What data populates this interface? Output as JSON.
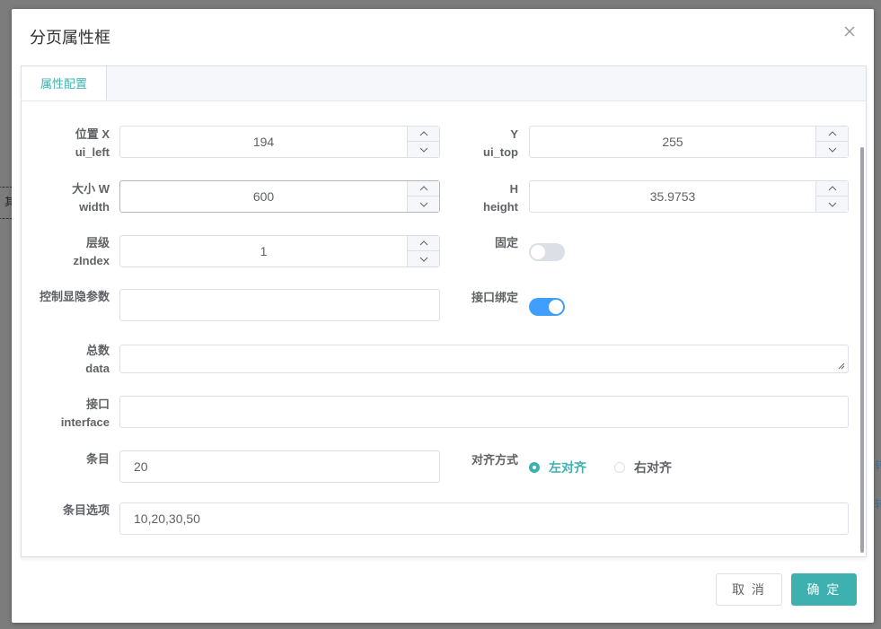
{
  "background": {
    "fragment_left": "其",
    "fragment_right_1": "转",
    "fragment_right_2": "转"
  },
  "dialog": {
    "title": "分页属性框",
    "tab_label": "属性配置",
    "fields": {
      "pos_x": {
        "label_line1": "位置 X",
        "label_line2": "ui_left",
        "value": "194"
      },
      "pos_y": {
        "label_line1": "Y",
        "label_line2": "ui_top",
        "value": "255"
      },
      "size_w": {
        "label_line1": "大小 W",
        "label_line2": "width",
        "value": "600"
      },
      "size_h": {
        "label_line1": "H",
        "label_line2": "height",
        "value": "35.9753"
      },
      "zindex": {
        "label_line1": "层级",
        "label_line2": "zIndex",
        "value": "1"
      },
      "fixed": {
        "label": "固定",
        "on": false
      },
      "visibility_param": {
        "label": "控制显隐参数",
        "value": ""
      },
      "api_binding": {
        "label": "接口绑定",
        "on": true
      },
      "total_data": {
        "label_line1": "总数",
        "label_line2": "data",
        "value": ""
      },
      "interface": {
        "label_line1": "接口",
        "label_line2": "interface",
        "value": ""
      },
      "items": {
        "label": "条目",
        "value": "20"
      },
      "align": {
        "label": "对齐方式",
        "options": [
          "左对齐",
          "右对齐"
        ],
        "selected": "左对齐"
      },
      "item_options": {
        "label": "条目选项",
        "value": "10,20,30,50"
      }
    },
    "buttons": {
      "cancel": "取 消",
      "ok": "确 定"
    },
    "colors": {
      "accent": "#3fb0b0",
      "switch_on": "#409eff",
      "switch_off": "#dcdfe6"
    }
  }
}
